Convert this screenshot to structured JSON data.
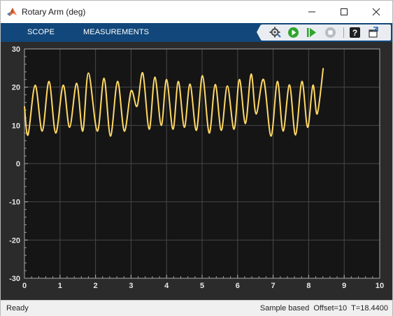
{
  "window": {
    "title": "Rotary Arm (deg)"
  },
  "toolstrip": {
    "tabs": [
      {
        "label": "SCOPE"
      },
      {
        "label": "MEASUREMENTS"
      }
    ],
    "buttons": [
      {
        "icon": "settings-icon"
      },
      {
        "icon": "run-icon"
      },
      {
        "icon": "step-forward-icon"
      },
      {
        "icon": "stop-icon"
      },
      {
        "icon": "help-icon"
      },
      {
        "icon": "undock-icon"
      }
    ]
  },
  "status": {
    "left": "Ready",
    "mode": "Sample based",
    "offset": "Offset=10",
    "time": "T=18.4400"
  },
  "chart_data": {
    "type": "line",
    "title": "",
    "xlabel": "",
    "ylabel": "",
    "xlim": [
      0,
      10
    ],
    "ylim": [
      -30,
      30
    ],
    "xticks": [
      "0",
      "1",
      "2",
      "3",
      "4",
      "5",
      "6",
      "7",
      "8",
      "9",
      "10"
    ],
    "yticks": [
      "30",
      "20",
      "10",
      "0",
      "-10",
      "-20",
      "-30"
    ],
    "grid": true,
    "colors": {
      "background": "#151515",
      "line": "#ffd866",
      "grid": "#474747",
      "axis_text": "#e6e6e6"
    },
    "series": [
      {
        "x": [
          0.0,
          0.1,
          0.3,
          0.5,
          0.69,
          0.88,
          1.09,
          1.27,
          1.47,
          1.64,
          1.8,
          2.05,
          2.24,
          2.42,
          2.62,
          2.81,
          3.0,
          3.17,
          3.33,
          3.51,
          3.67,
          3.85,
          4.0,
          4.18,
          4.33,
          4.5,
          4.66,
          4.84,
          5.01,
          5.2,
          5.37,
          5.54,
          5.71,
          5.9,
          6.05,
          6.22,
          6.38,
          6.52,
          6.73,
          6.94,
          7.12,
          7.28,
          7.46,
          7.63,
          7.81,
          7.97,
          8.12,
          8.24,
          8.41
        ],
        "y": [
          15,
          7.5,
          20.5,
          8.5,
          21.5,
          8,
          20.5,
          9.5,
          21,
          8.5,
          23.7,
          8.5,
          22.3,
          7.2,
          21.5,
          8.5,
          19,
          15,
          23.7,
          9,
          22.6,
          10,
          22,
          9,
          21.5,
          9.5,
          20.8,
          8.7,
          23,
          8,
          20.7,
          8.7,
          20.3,
          9,
          22,
          10.5,
          23.4,
          13,
          22,
          7.2,
          21.5,
          8.5,
          20.6,
          7.5,
          21.5,
          9.5,
          20.5,
          13,
          25
        ]
      }
    ]
  }
}
